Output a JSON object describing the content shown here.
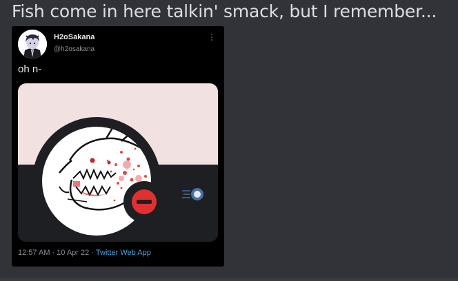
{
  "message": {
    "text": "Fish come in here talkin' smack, but I remember..."
  },
  "tweet": {
    "display_name": "H2oSakana",
    "handle": "@h2osakana",
    "text": "oh n-",
    "time": "12:57 AM",
    "date": "10 Apr 22",
    "separator": "·",
    "source": "Twitter Web App",
    "avatar_icon": "anime-character-avatar",
    "more_icon": "more-options-icon",
    "media": {
      "description_icon": "shark-profile-picture-with-blocked-badge",
      "top_color": "#f2e1e1",
      "bottom_color": "#1e1f22",
      "block_badge_color": "#e03131",
      "blur_color": "#d11f1f",
      "toggle_color": "#4a6fa5"
    }
  },
  "colors": {
    "background": "#313338",
    "message_text": "#dbdee1",
    "card_background": "#000000",
    "link": "#4aa4e8",
    "meta": "#8b8f94"
  }
}
